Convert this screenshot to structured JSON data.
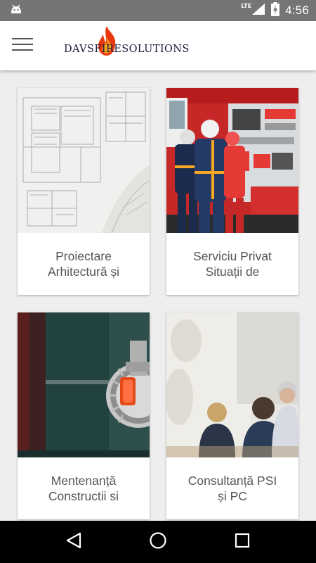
{
  "status_bar": {
    "time": "4:56",
    "network": "LTE",
    "icons": [
      "android-icon",
      "signal-icon",
      "battery-charging-icon"
    ]
  },
  "app_bar": {
    "menu_icon": "hamburger-menu-icon",
    "logo_text": "DAVSFIRESOLUTIONS"
  },
  "cards": [
    {
      "title": "Proiectare\nArhitectură și",
      "image": "architectural-blueprints"
    },
    {
      "title": "Serviciu Privat\nSituații de",
      "image": "firefighters-at-truck"
    },
    {
      "title": "Mentenanță\nConstructii si",
      "image": "fire-sprinkler"
    },
    {
      "title": "Consultanță PSI\nși PC",
      "image": "seminar-audience"
    }
  ],
  "nav_bar": {
    "back_icon": "back-triangle-icon",
    "home_icon": "home-circle-icon",
    "recents_icon": "recents-square-icon"
  },
  "colors": {
    "status_bar": "#757575",
    "app_bar": "#ffffff",
    "background": "#eeeeee",
    "card_text": "#555555",
    "nav_bar": "#000000"
  }
}
